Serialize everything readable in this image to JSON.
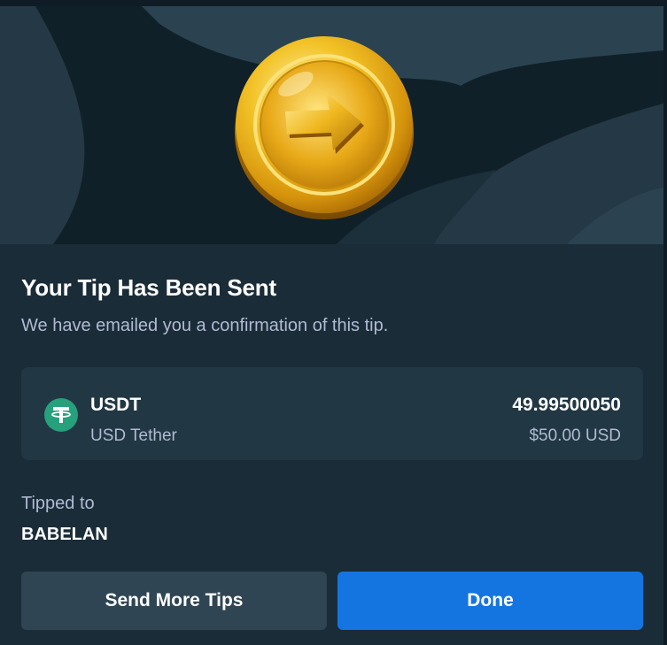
{
  "colors": {
    "modal_bg": "#1a2c38",
    "hero_bg": "#102029",
    "card_bg": "#213743",
    "secondary_button": "#2f4553",
    "primary_button": "#1475e1",
    "muted_text": "#b1bad3",
    "tether_green": "#26a17b",
    "coin_gold": "#f2b617"
  },
  "hero": {
    "image": "gold-coin-arrow-icon"
  },
  "confirmation": {
    "title": "Your Tip Has Been Sent",
    "subtitle": "We have emailed you a confirmation of this tip."
  },
  "token": {
    "icon": "tether-icon",
    "symbol": "USDT",
    "name": "USD Tether",
    "amount": "49.99500050",
    "fiat_value": "$50.00 USD"
  },
  "recipient": {
    "label": "Tipped to",
    "username": "BABELAN"
  },
  "actions": {
    "send_more_label": "Send More Tips",
    "done_label": "Done"
  }
}
